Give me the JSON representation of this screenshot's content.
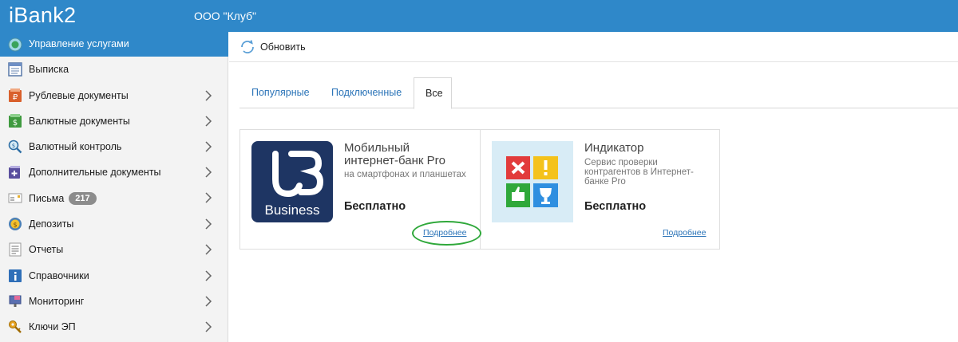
{
  "header": {
    "logo": "iBank2",
    "org": "ООО \"Клуб\""
  },
  "sidebar": {
    "head": {
      "label": "Управление услугами",
      "icon": "services-icon"
    },
    "items": [
      {
        "label": "Выписка",
        "icon": "statement-icon",
        "chevron": false
      },
      {
        "label": "Рублевые документы",
        "icon": "ruble-docs-icon",
        "chevron": true
      },
      {
        "label": "Валютные документы",
        "icon": "currency-docs-icon",
        "chevron": true
      },
      {
        "label": "Валютный контроль",
        "icon": "currency-control-icon",
        "chevron": true
      },
      {
        "label": "Дополнительные документы",
        "icon": "additional-docs-icon",
        "chevron": true
      },
      {
        "label": "Письма",
        "icon": "letters-icon",
        "badge": "217",
        "chevron": true
      },
      {
        "label": "Депозиты",
        "icon": "deposits-icon",
        "chevron": true
      },
      {
        "label": "Отчеты",
        "icon": "reports-icon",
        "chevron": true
      },
      {
        "label": "Справочники",
        "icon": "references-icon",
        "chevron": true
      },
      {
        "label": "Мониторинг",
        "icon": "monitoring-icon",
        "chevron": true
      },
      {
        "label": "Ключи ЭП",
        "icon": "keys-icon",
        "chevron": true
      }
    ]
  },
  "toolbar": {
    "refresh_label": "Обновить"
  },
  "tabs": [
    {
      "label": "Популярные",
      "active": false
    },
    {
      "label": "Подключенные",
      "active": false
    },
    {
      "label": "Все",
      "active": true
    }
  ],
  "cards": [
    {
      "title_line1": "Мобильный",
      "title_line2": "интернет-банк Pro",
      "subtitle_line1": "на смартфонах и планшетах",
      "price": "Бесплатно",
      "link": "Подробнее",
      "logo_text": "Business"
    },
    {
      "title_line1": "Индикатор",
      "subtitle_line1": "Сервис проверки",
      "subtitle_line2": "контрагентов в Интернет-",
      "subtitle_line3": "банке Pro",
      "price": "Бесплатно",
      "link": "Подробнее"
    }
  ],
  "colors": {
    "header": "#2f88c9",
    "link": "#2b74b8",
    "highlight": "#2fa83a"
  }
}
